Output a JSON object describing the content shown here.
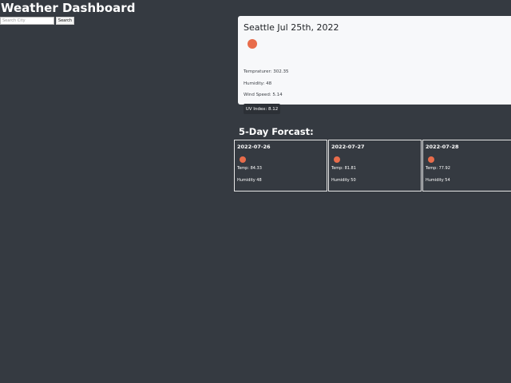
{
  "header": {
    "title": "Weather Dashboard"
  },
  "search": {
    "placeholder": "Search City",
    "button_label": "Search"
  },
  "current": {
    "title": "Seattle Jul 25th, 2022",
    "icon": "weather-icon",
    "temperature": "Tempraturer: 302.35",
    "humidity": "Humidity: 48",
    "wind": "Wind Speed: 5.14",
    "uv_label": "UV Index: 8.12"
  },
  "forecast": {
    "heading": "5-Day Forcast:",
    "days": [
      {
        "date": "2022-07-26",
        "temp": "Temp: 84.33",
        "humidity": "Humidity 48"
      },
      {
        "date": "2022-07-27",
        "temp": "Temp: 81.81",
        "humidity": "Humidity 50"
      },
      {
        "date": "2022-07-28",
        "temp": "Temp: 77.92",
        "humidity": "Humidity 54"
      }
    ]
  },
  "colors": {
    "background": "#353a41",
    "card_background": "#f7f8fa",
    "icon": "#e86c4b",
    "uv_badge": "#2c3036"
  }
}
